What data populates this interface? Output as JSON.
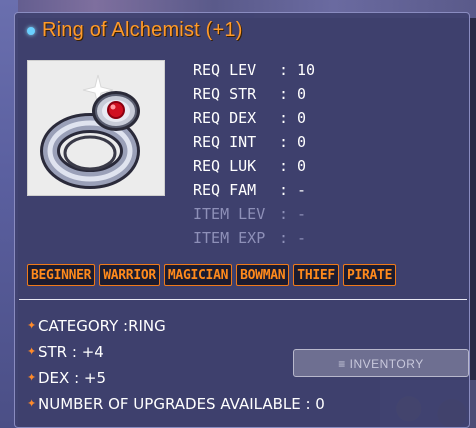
{
  "item": {
    "name": "Ring of Alchemist (+1)",
    "icon": "silver-ring-red-gem-icon"
  },
  "requirements": [
    {
      "label": "REQ LEV",
      "value": "10"
    },
    {
      "label": "REQ STR",
      "value": "0"
    },
    {
      "label": "REQ DEX",
      "value": "0"
    },
    {
      "label": "REQ INT",
      "value": "0"
    },
    {
      "label": "REQ LUK",
      "value": "0"
    },
    {
      "label": "REQ FAM",
      "value": "-"
    }
  ],
  "item_progress": [
    {
      "label": "ITEM LEV",
      "value": "-"
    },
    {
      "label": "ITEM EXP",
      "value": "-"
    }
  ],
  "jobs": [
    "BEGINNER",
    "WARRIOR",
    "MAGICIAN",
    "BOWMAN",
    "THIEF",
    "PIRATE"
  ],
  "stats": [
    {
      "text": "CATEGORY :RING"
    },
    {
      "text": "STR : +4"
    },
    {
      "text": "DEX : +5"
    },
    {
      "text": "NUMBER OF UPGRADES AVAILABLE : 0"
    }
  ],
  "inventory_button": {
    "label": "≡ INVENTORY"
  },
  "colors": {
    "title": "#ff9a2a",
    "job_badge": "#ff8a1c",
    "bullet": "#ff8a2a",
    "panel": "#404270"
  }
}
